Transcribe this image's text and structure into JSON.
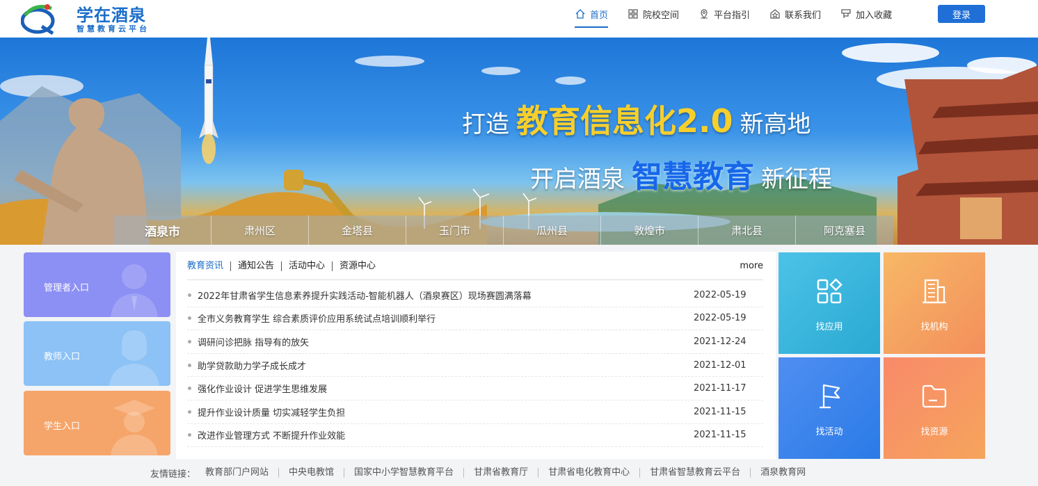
{
  "brand": {
    "title": "学在酒泉",
    "subtitle": "智慧教育云平台"
  },
  "nav": {
    "items": [
      {
        "label": "首页",
        "icon": "home-icon",
        "active": true
      },
      {
        "label": "院校空间",
        "icon": "grid-icon"
      },
      {
        "label": "平台指引",
        "icon": "location-icon"
      },
      {
        "label": "联系我们",
        "icon": "star-home-icon"
      },
      {
        "label": "加入收藏",
        "icon": "bookmark-icon"
      }
    ],
    "login_label": "登录"
  },
  "banner": {
    "line1_pre": "打造",
    "line1_highlight": "教育信息化2.0",
    "line1_post": "新高地",
    "line2_pre": "开启酒泉",
    "line2_highlight": "智慧教育",
    "line2_post": "新征程",
    "districts": [
      "酒泉市",
      "肃州区",
      "金塔县",
      "玉门市",
      "瓜州县",
      "敦煌市",
      "肃北县",
      "阿克塞县"
    ]
  },
  "entries": [
    {
      "label": "管理者入口",
      "color": "#8c8ff3"
    },
    {
      "label": "教师入口",
      "color": "#8cc2f5"
    },
    {
      "label": "学生入口",
      "color": "#f6a56a"
    }
  ],
  "news": {
    "tabs": [
      "教育资讯",
      "通知公告",
      "活动中心",
      "资源中心"
    ],
    "more_label": "more",
    "items": [
      {
        "title": "2022年甘肃省学生信息素养提升实践活动-智能机器人（酒泉赛区）现场赛圆满落幕",
        "date": "2022-05-19"
      },
      {
        "title": "全市义务教育学生 综合素质评价应用系统试点培训顺利举行",
        "date": "2022-05-19"
      },
      {
        "title": "调研问诊把脉 指导有的放矢",
        "date": "2021-12-24"
      },
      {
        "title": "助学贷款助力学子成长成才",
        "date": "2021-12-01"
      },
      {
        "title": "强化作业设计 促进学生思维发展",
        "date": "2021-11-17"
      },
      {
        "title": "提升作业设计质量 切实减轻学生负担",
        "date": "2021-11-15"
      },
      {
        "title": "改进作业管理方式 不断提升作业效能",
        "date": "2021-11-15"
      }
    ]
  },
  "tiles": [
    {
      "label": "找应用",
      "icon": "apps-icon"
    },
    {
      "label": "找机构",
      "icon": "building-icon"
    },
    {
      "label": "找活动",
      "icon": "flag-icon"
    },
    {
      "label": "找资源",
      "icon": "folder-icon"
    }
  ],
  "footer": {
    "links_label": "友情链接：",
    "links": [
      "教育部门户网站",
      "中央电教馆",
      "国家中小学智慧教育平台",
      "甘肃省教育厅",
      "甘肃省电化教育中心",
      "甘肃省智慧教育云平台",
      "酒泉教育网"
    ]
  }
}
